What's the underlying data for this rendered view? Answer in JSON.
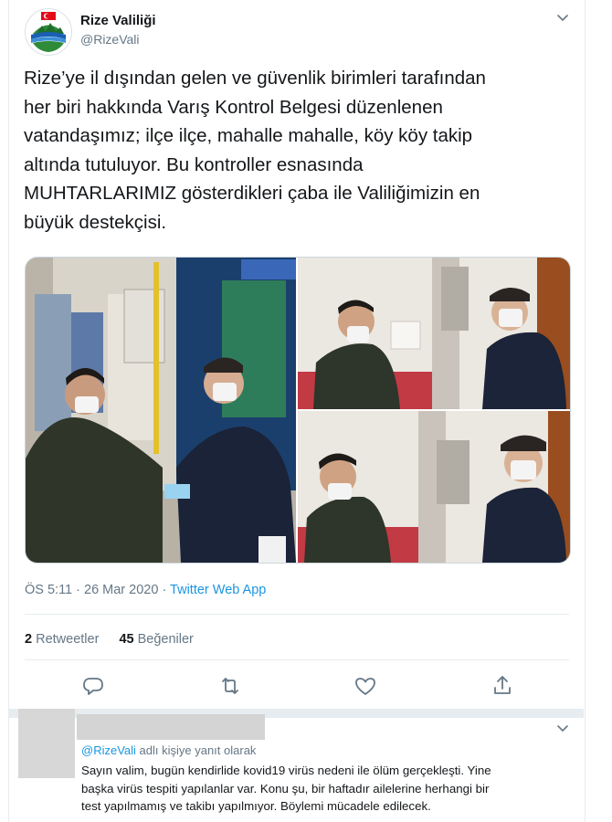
{
  "tweet": {
    "author_name": "Rize Valiliği",
    "author_handle": "@RizeVali",
    "text": "Rize’ye il dışından gelen ve güvenlik birimleri tarafından\nher biri hakkında Varış Kontrol Belgesi düzenlenen\nvatandaşımız; ilçe ilçe, mahalle mahalle, köy köy takip\naltında tutuluyor. Bu kontroller esnasında\nMUHTARLARIMIZ gösterdikleri çaba ile Valiliğimizin en\nbüyük destekçisi.",
    "timestamp": "ÖS 5:11 · 26 Mar 2020 · ",
    "source": "Twitter Web App",
    "retweets_count": "2",
    "retweets_label": "Retweetler",
    "likes_count": "45",
    "likes_label": "Beğeniler"
  },
  "media": {
    "photos": [
      {
        "icon": "photo-masked-men-handing-document"
      },
      {
        "icon": "photo-masked-men-at-door"
      },
      {
        "icon": "photo-masked-men-at-door-closeup"
      }
    ]
  },
  "actions": [
    {
      "icon": "reply-icon"
    },
    {
      "icon": "retweet-icon"
    },
    {
      "icon": "like-icon"
    },
    {
      "icon": "share-icon"
    }
  ],
  "reply": {
    "replying_to_handle": "@RizeVali",
    "replying_to_suffix": " adlı kişiye yanıt olarak",
    "text": "Sayın valim, bugün kendirlide kovid19 virüs nedeni ile ölüm gerçekleşti. Yine\nbaşka virüs tespiti yapılanlar var. Konu şu, bir haftadır ailelerine herhangi bir\ntest yapılmamış ve takibı yapılmıyor. Böylemi mücadele edilecek."
  },
  "colors": {
    "link": "#1b95e0",
    "secondary_text": "#657786",
    "divider": "#e6ecf0"
  }
}
